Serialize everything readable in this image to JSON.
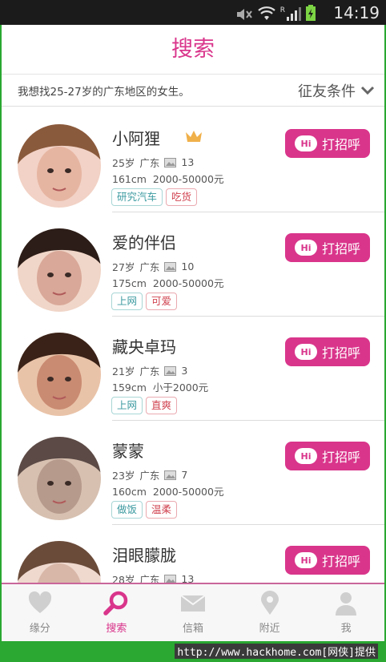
{
  "status": {
    "time": "14:19",
    "signal_label": "R"
  },
  "header": {
    "title": "搜索"
  },
  "filter": {
    "description": "我想找25-27岁的广东地区的女生。",
    "button_label": "征友条件"
  },
  "users": [
    {
      "name": "小阿狸",
      "vip": true,
      "age": "25岁",
      "region": "广东",
      "photos": "13",
      "height": "161cm",
      "income": "2000-50000元",
      "tags": [
        "研究汽车",
        "吃货"
      ],
      "hi_label": "打招呼"
    },
    {
      "name": "爱的伴侣",
      "vip": false,
      "age": "27岁",
      "region": "广东",
      "photos": "10",
      "height": "175cm",
      "income": "2000-50000元",
      "tags": [
        "上网",
        "可爱"
      ],
      "hi_label": "打招呼"
    },
    {
      "name": "藏央卓玛",
      "vip": false,
      "age": "21岁",
      "region": "广东",
      "photos": "3",
      "height": "159cm",
      "income": "小于2000元",
      "tags": [
        "上网",
        "直爽"
      ],
      "hi_label": "打招呼"
    },
    {
      "name": "蒙蒙",
      "vip": false,
      "age": "23岁",
      "region": "广东",
      "photos": "7",
      "height": "160cm",
      "income": "2000-50000元",
      "tags": [
        "做饭",
        "温柔"
      ],
      "hi_label": "打招呼"
    },
    {
      "name": "泪眼朦胧",
      "vip": false,
      "age": "28岁",
      "region": "广东",
      "photos": "13",
      "height": "",
      "income": "",
      "tags": [],
      "hi_label": "打招呼"
    }
  ],
  "hi_badge": "Hi",
  "tabs": [
    {
      "label": "缘分",
      "icon": "heart-icon",
      "active": false
    },
    {
      "label": "搜索",
      "icon": "search-icon",
      "active": true
    },
    {
      "label": "信箱",
      "icon": "mail-icon",
      "active": false
    },
    {
      "label": "附近",
      "icon": "location-pin-icon",
      "active": false
    },
    {
      "label": "我",
      "icon": "person-icon",
      "active": false
    }
  ],
  "footer": {
    "watermark": "http://www.hackhome.com[网侠]提供"
  },
  "colors": {
    "accent": "#d9358b",
    "statusbar": "#1b1b1b",
    "frame": "#2aa832"
  }
}
